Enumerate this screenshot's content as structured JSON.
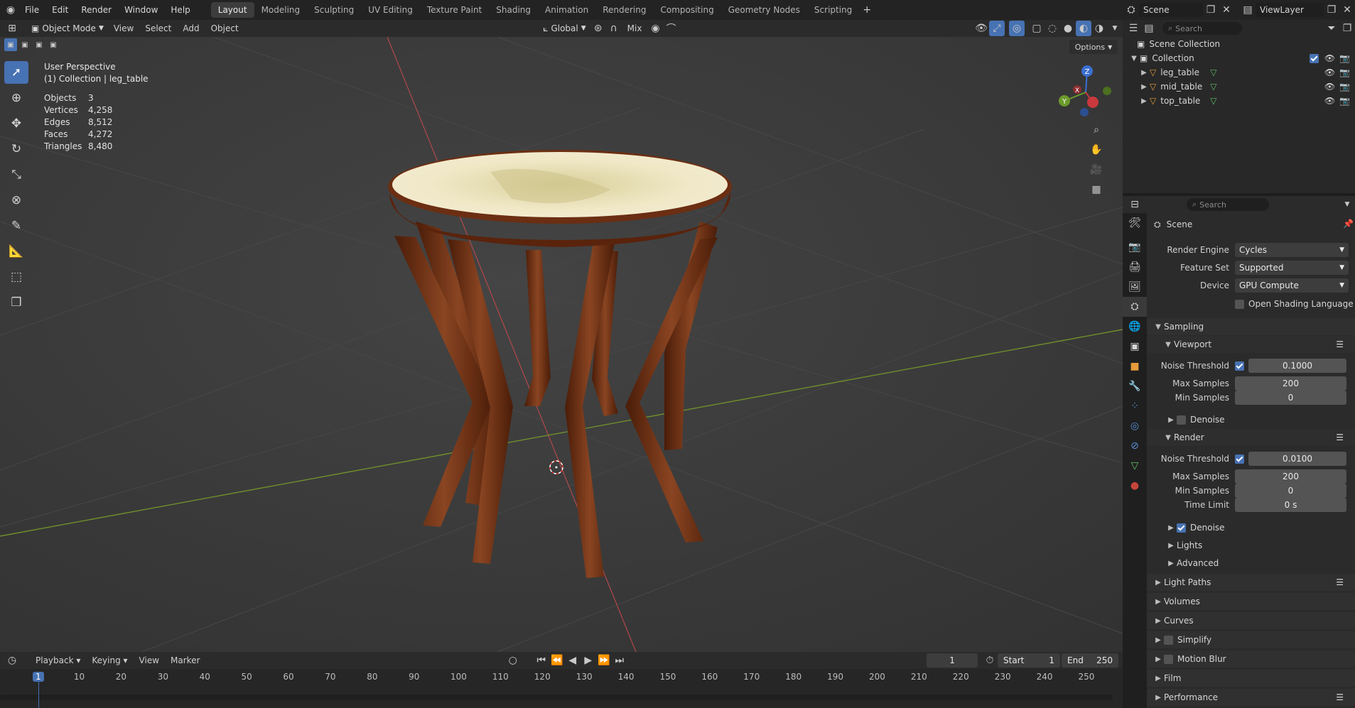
{
  "menu": [
    "File",
    "Edit",
    "Render",
    "Window",
    "Help"
  ],
  "workspaces": [
    "Layout",
    "Modeling",
    "Sculpting",
    "UV Editing",
    "Texture Paint",
    "Shading",
    "Animation",
    "Rendering",
    "Compositing",
    "Geometry Nodes",
    "Scripting"
  ],
  "active_workspace": "Layout",
  "scene_name": "Scene",
  "view_layer": "ViewLayer",
  "viewport_header": {
    "mode": "Object Mode",
    "menus": [
      "View",
      "Select",
      "Add",
      "Object"
    ],
    "transform_orientation": "Global",
    "pivot": "Mix",
    "options": "Options"
  },
  "viewport_overlay": {
    "perspective": "User Perspective",
    "collection": "(1) Collection | leg_table",
    "stats": [
      {
        "label": "Objects",
        "value": "3"
      },
      {
        "label": "Vertices",
        "value": "4,258"
      },
      {
        "label": "Edges",
        "value": "8,512"
      },
      {
        "label": "Faces",
        "value": "4,272"
      },
      {
        "label": "Triangles",
        "value": "8,480"
      }
    ]
  },
  "gizmo": {
    "z": "Z",
    "x": "X",
    "y": "Y"
  },
  "outliner": {
    "search_placeholder": "Search",
    "root": "Scene Collection",
    "collection": "Collection",
    "objects": [
      "leg_table",
      "mid_table",
      "top_table"
    ]
  },
  "properties": {
    "search_placeholder": "Search",
    "context": "Scene",
    "render_engine_label": "Render Engine",
    "render_engine": "Cycles",
    "feature_set_label": "Feature Set",
    "feature_set": "Supported",
    "device_label": "Device",
    "device": "GPU Compute",
    "osl_label": "Open Shading Language",
    "sampling": "Sampling",
    "viewport": "Viewport",
    "noise_threshold_label": "Noise Threshold",
    "viewport_noise_threshold": "0.1000",
    "max_samples_label": "Max Samples",
    "viewport_max_samples": "200",
    "min_samples_label": "Min Samples",
    "viewport_min_samples": "0",
    "denoise_label": "Denoise",
    "render": "Render",
    "render_noise_threshold": "0.0100",
    "render_max_samples": "200",
    "render_min_samples": "0",
    "time_limit_label": "Time Limit",
    "time_limit": "0 s",
    "lights": "Lights",
    "advanced": "Advanced",
    "panels": [
      "Light Paths",
      "Volumes",
      "Curves",
      "Simplify",
      "Motion Blur",
      "Film",
      "Performance"
    ]
  },
  "timeline": {
    "menus": [
      "Playback",
      "Keying",
      "View",
      "Marker"
    ],
    "current_frame": "1",
    "start_label": "Start",
    "start": "1",
    "end_label": "End",
    "end": "250",
    "ticks": [
      "1",
      "10",
      "20",
      "30",
      "40",
      "50",
      "60",
      "70",
      "80",
      "90",
      "100",
      "110",
      "120",
      "130",
      "140",
      "150",
      "160",
      "170",
      "180",
      "190",
      "200",
      "210",
      "220",
      "230",
      "240",
      "250"
    ]
  },
  "colors": {
    "accent": "#4772b3",
    "x_axis": "#c0504d",
    "y_axis": "#7a9c3a",
    "wood": "#6b2e12",
    "tabletop": "#e6dcb8"
  }
}
